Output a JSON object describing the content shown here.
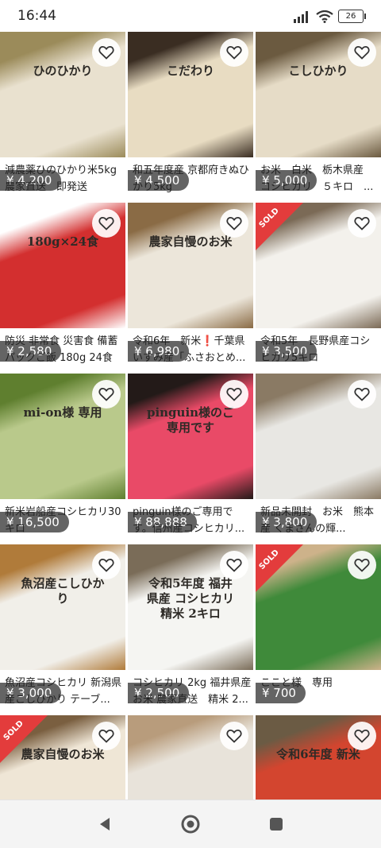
{
  "status": {
    "time": "16:44",
    "battery": "26",
    "wifi_icon": "wifi-icon",
    "signal_icon": "signal-icon"
  },
  "items": [
    {
      "price": "¥ 4,200",
      "title": "減農薬ひのひかり米5kg　農家直送　即発送",
      "sold": false,
      "thumb_text": "ひのひかり",
      "colors": [
        "#9b8b5a",
        "#e9e1cf"
      ]
    },
    {
      "price": "¥ 4,500",
      "title": "和五年度産 京都府きぬひかり5kg",
      "sold": false,
      "thumb_text": "こだわり",
      "colors": [
        "#3a2d22",
        "#e8dcc2"
      ]
    },
    {
      "price": "¥ 5,000",
      "title": "お米　白米　栃木県産　コシヒカリ　５キロ　...",
      "sold": false,
      "thumb_text": "こしひかり",
      "colors": [
        "#6b5a40",
        "#e6dcc7"
      ]
    },
    {
      "price": "¥ 2,580",
      "title": "防災 非常食 災害食 備蓄パックご飯 180g 24食 ...",
      "sold": false,
      "thumb_text": "180g×24食",
      "colors": [
        "#ffffff",
        "#d32f2f"
      ]
    },
    {
      "price": "¥ 6,980",
      "title": "令和6年　新米❗千葉県いすみ産「ふさおとめ...",
      "sold": false,
      "thumb_text": "農家自慢のお米",
      "colors": [
        "#8a6b45",
        "#ece6da"
      ]
    },
    {
      "price": "¥ 3,500",
      "title": "令和5年　長野県産コシヒカリ5キロ",
      "sold": true,
      "thumb_text": "",
      "colors": [
        "#7b6a56",
        "#f3f1ec"
      ]
    },
    {
      "price": "¥ 16,500",
      "title": "新米岩船産コシヒカリ30キロ",
      "sold": false,
      "thumb_text": "mi-on様 専用",
      "colors": [
        "#5f7f2f",
        "#b9c98b"
      ]
    },
    {
      "price": "¥ 88,888",
      "title": "pinguin様のご専用です。信州産コシヒカリ...",
      "sold": false,
      "thumb_text": "pinguin様のご専用です",
      "colors": [
        "#231a18",
        "#e94a67"
      ]
    },
    {
      "price": "¥ 3,800",
      "title": "新品未開封　お米　熊本産 くまさんの輝...",
      "sold": false,
      "thumb_text": "",
      "colors": [
        "#8a7a64",
        "#e8e7e3"
      ]
    },
    {
      "price": "¥ 3,000",
      "title": "魚沼産コシヒカリ 新潟県産こしひかり テーブ...",
      "sold": false,
      "thumb_text": "魚沼産こしひかり",
      "colors": [
        "#b07b3a",
        "#f1efe9"
      ]
    },
    {
      "price": "¥ 2,500",
      "title": "コシヒカリ 2kg 福井県産 お米 農家直送　精米 2...",
      "sold": false,
      "thumb_text": "令和5年度 福井県産 コシヒカリ 精米 2キロ",
      "colors": [
        "#7a6c58",
        "#f5f5f2"
      ]
    },
    {
      "price": "¥ 700",
      "title": "ここと様　専用",
      "sold": true,
      "thumb_text": "",
      "colors": [
        "#cdb28a",
        "#3f8a3a"
      ]
    },
    {
      "price": "",
      "title": "",
      "sold": true,
      "thumb_text": "農家自慢のお米",
      "colors": [
        "#7a5f40",
        "#efe6d6"
      ]
    },
    {
      "price": "",
      "title": "",
      "sold": false,
      "thumb_text": "",
      "colors": [
        "#b89c7c",
        "#e8e3da"
      ]
    },
    {
      "price": "",
      "title": "",
      "sold": false,
      "thumb_text": "令和6年度 新米",
      "colors": [
        "#6b5b44",
        "#d3452f"
      ]
    }
  ],
  "nav": {
    "back_icon": "back-triangle-icon",
    "home_icon": "home-circle-icon",
    "recents_icon": "recents-square-icon"
  }
}
